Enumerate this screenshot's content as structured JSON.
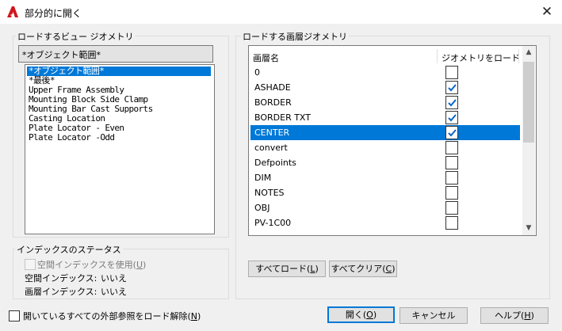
{
  "window": {
    "title": "部分的に開く",
    "icon": "autocad-icon",
    "close_glyph": "✕"
  },
  "left_group": {
    "label": "ロードするビュー ジオメトリ",
    "combo_value": "*オブジェクト範囲*",
    "views": [
      {
        "label": "*オブジェクト範囲*",
        "selected": true
      },
      {
        "label": "*最後*",
        "selected": false
      },
      {
        "label": "Upper Frame Assembly",
        "selected": false
      },
      {
        "label": "Mounting Block Side Clamp",
        "selected": false
      },
      {
        "label": "Mounting Bar Cast Supports",
        "selected": false
      },
      {
        "label": "Casting Location",
        "selected": false
      },
      {
        "label": "Plate Locator - Even",
        "selected": false
      },
      {
        "label": "Plate Locator -Odd",
        "selected": false
      }
    ]
  },
  "right_group": {
    "label": "ロードする画層ジオメトリ",
    "col_name": "画層名",
    "col_geometry": "ジオメトリをロード",
    "layers": [
      {
        "name": "0",
        "checked": false,
        "selected": false
      },
      {
        "name": "ASHADE",
        "checked": true,
        "selected": false
      },
      {
        "name": "BORDER",
        "checked": true,
        "selected": false
      },
      {
        "name": "BORDER TXT",
        "checked": true,
        "selected": false
      },
      {
        "name": "CENTER",
        "checked": true,
        "selected": true
      },
      {
        "name": "convert",
        "checked": false,
        "selected": false
      },
      {
        "name": "Defpoints",
        "checked": false,
        "selected": false
      },
      {
        "name": "DIM",
        "checked": false,
        "selected": false
      },
      {
        "name": "NOTES",
        "checked": false,
        "selected": false
      },
      {
        "name": "OBJ",
        "checked": false,
        "selected": false
      },
      {
        "name": "PV-1C00",
        "checked": false,
        "selected": false
      }
    ],
    "load_all_button": {
      "text": "すべてロード(",
      "key": "L",
      "end": ")"
    },
    "clear_all_button": {
      "text": "すべてクリア(",
      "key": "C",
      "end": ")"
    }
  },
  "index_group": {
    "label": "インデックスのステータス",
    "use_spatial_index": {
      "text": "空間インデックスを使用(",
      "key": "U",
      "end": ")",
      "checked": false,
      "enabled": false
    },
    "spatial_index_label": "空間インデックス:",
    "spatial_index_value": "いいえ",
    "layer_index_label": "画層インデックス:",
    "layer_index_value": "いいえ"
  },
  "footer": {
    "unload_xrefs": {
      "text": "開いているすべての外部参照をロード解除(",
      "key": "N",
      "end": ")",
      "checked": false
    },
    "open_button": {
      "text": "開く(",
      "key": "O",
      "end": ")"
    },
    "cancel_button": "キャンセル",
    "help_button": {
      "text": "ヘルプ(",
      "key": "H",
      "end": ")"
    }
  },
  "colors": {
    "selection": "#0078d7",
    "check": "#0a64c8",
    "autocad_red": "#d0161c"
  }
}
